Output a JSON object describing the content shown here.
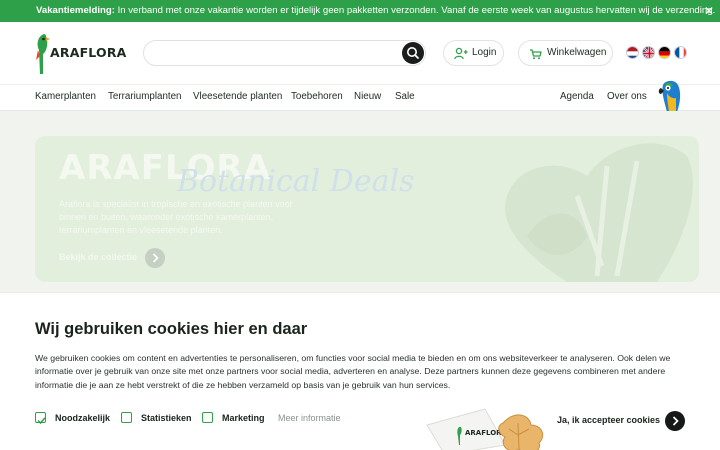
{
  "announcement": {
    "label": "Vakantiemelding:",
    "text": " In verband met onze vakantie worden er tijdelijk geen pakketten verzonden. Vanaf de eerste week van augustus hervatten wij de verzending.",
    "close_icon": "close-icon"
  },
  "header": {
    "logo_text": "ARAFLORA",
    "search": {
      "placeholder": "",
      "value": "",
      "icon": "search-icon"
    },
    "login_label": "Login",
    "cart_label": "Winkelwagen",
    "languages": [
      "nl",
      "en",
      "de",
      "fr"
    ]
  },
  "nav": {
    "items": [
      "Kamerplanten",
      "Terrariumplanten",
      "Vleesetende planten",
      "Toebehoren",
      "Nieuw",
      "Sale"
    ],
    "right_items": [
      "Agenda",
      "Over ons"
    ]
  },
  "hero": {
    "brand": "ARAFLORA",
    "script_title": "Botanical Deals",
    "description": "Araflora is specialist in tropische en exotische planten voor binnen en buiten, waaronder exotische kamerplanten, terrariumplanten en vleesetende planten.",
    "cta": "Bekijk de collectie"
  },
  "cookie": {
    "title": "Wij gebruiken cookies hier en daar",
    "body": "We gebruiken cookies om content en advertenties te personaliseren, om functies voor social media te bieden en om ons websiteverkeer te analyseren. Ook delen we informatie over je gebruik van onze site met onze partners voor social media, adverteren en analyse. Deze partners kunnen deze gegevens combineren met andere informatie die je aan ze hebt verstrekt of die ze hebben verzameld op basis van je gebruik van hun services.",
    "options": [
      {
        "label": "Noodzakelijk",
        "checked": true
      },
      {
        "label": "Statistieken",
        "checked": false
      },
      {
        "label": "Marketing",
        "checked": false
      }
    ],
    "more_info": "Meer informatie",
    "accept_label": "Ja, ik accepteer cookies",
    "bag_logo": "ARAFLORA"
  },
  "colors": {
    "brand_green": "#2fa04a",
    "dark": "#161917"
  }
}
